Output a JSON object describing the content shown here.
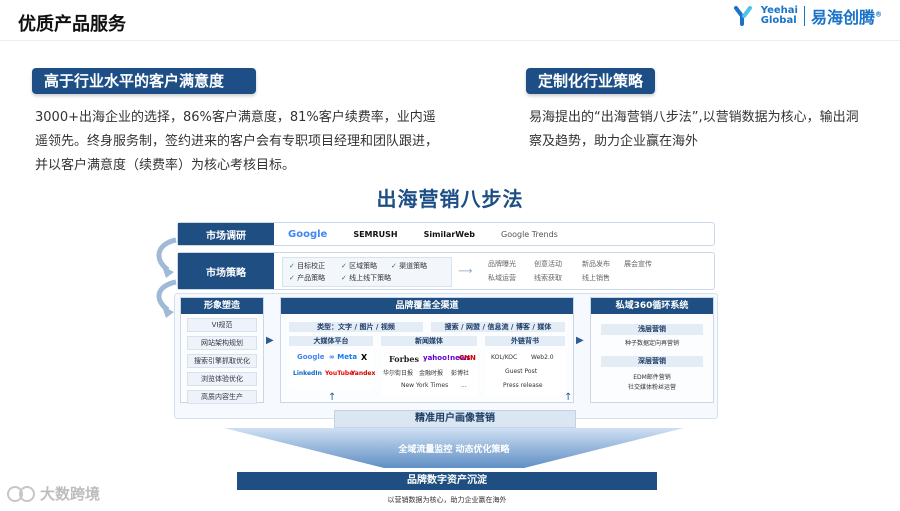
{
  "title": "优质产品服务",
  "brand": {
    "en_line1": "Yeehai",
    "en_line2": "Global",
    "cn": "易海创腾",
    "reg": "®",
    "accent": "#1a73c8"
  },
  "left": {
    "tag": "高于行业水平的客户满意度",
    "paragraph": "3000+出海企业的选择，86%客户满意度，81%客户续费率，业内遥遥领先。终身服务制，签约进来的客户会有专职项目经理和团队跟进，并以客户满意度（续费率）为核心考核目标。"
  },
  "right": {
    "tag": "定制化行业策略",
    "paragraph": "易海提出的“出海营销八步法”,以营销数据为核心，输出洞察及趋势，助力企业赢在海外"
  },
  "diagram": {
    "title": "出海营销八步法",
    "row1": {
      "label": "市场调研",
      "logos": [
        "Google",
        "SEMRUSH",
        "SimilarWeb",
        "Google Trends"
      ]
    },
    "row2": {
      "label": "市场策略",
      "checks": [
        "目标校正",
        "区域策略",
        "渠道策略",
        "产品策略",
        "线上线下策略"
      ],
      "outcomes": [
        "品牌曝光",
        "创意活动",
        "新品发布",
        "展会宣传",
        "私域运营",
        "线索获取",
        "线上销售"
      ]
    },
    "col_left": {
      "header": "形象塑造",
      "items": [
        "VI规范",
        "网站架构规划",
        "搜索引擎抓取优化",
        "浏览体验优化",
        "高质内容生产"
      ]
    },
    "col_mid": {
      "header": "品牌覆盖全渠道",
      "bar1": "类型：文字 / 图片 / 视频",
      "bar2": "搜索 / 网盟 / 信息流 / 博客 / 媒体",
      "sub_big": "大媒体平台",
      "sub_news": "新闻媒体",
      "sub_out": "外链背书",
      "big_logos": [
        "Google",
        "Meta",
        "X",
        "LinkedIn",
        "YouTube",
        "Yandex"
      ],
      "news": [
        "Forbes",
        "yahoo!news",
        "CNN",
        "华尔街日报",
        "金融时报",
        "彭博社",
        "New York Times",
        "..."
      ],
      "out": [
        "KOL/KOC",
        "Web2.0",
        "Guest Post",
        "Press release"
      ]
    },
    "col_right": {
      "header": "私域360循环系统",
      "sub1": "浅层营销",
      "item1": "种子数据定向再营销",
      "sub2": "深层营销",
      "item2a": "EDM邮件营销",
      "item2b": "社交媒体粉丝运营"
    },
    "bar_precise": "精准用户画像营销",
    "funnel_text": "全域流量监控 动态优化策略",
    "bar_assets": "品牌数字资产沉淀",
    "footer": "以营销数据为核心，助力企业赢在海外"
  },
  "watermark": "大数跨境",
  "colors": {
    "navy": "#1f4f82",
    "light_blue": "#e4ecf6",
    "news_red": "#c00"
  }
}
